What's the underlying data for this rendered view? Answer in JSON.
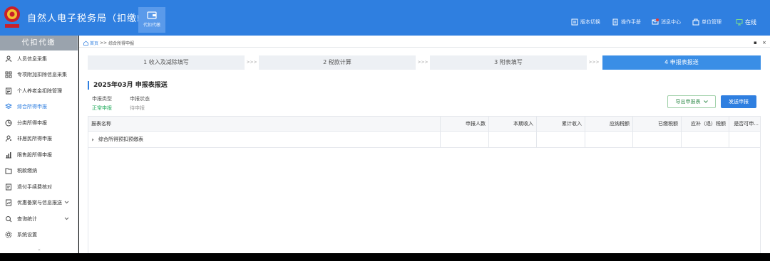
{
  "header": {
    "title": "自然人电子税务局（扣缴端）",
    "module_label": "代扣代缴",
    "actions": [
      {
        "label": "版本切换",
        "icon": "version-switch-icon"
      },
      {
        "label": "操作手册",
        "icon": "manual-icon"
      },
      {
        "label": "消息中心",
        "icon": "message-icon"
      },
      {
        "label": "单位管理",
        "icon": "org-icon"
      }
    ],
    "online_label": "在线",
    "message_badge": "7"
  },
  "sidebar": {
    "title": "代扣代缴",
    "items": [
      {
        "label": "人员信息采集",
        "icon": "person-icon"
      },
      {
        "label": "专项附加扣除信息采集",
        "icon": "grid-icon"
      },
      {
        "label": "个人养老金扣除管理",
        "icon": "doc-icon"
      },
      {
        "label": "综合所得申报",
        "icon": "layers-icon",
        "active": true
      },
      {
        "label": "分类所得申报",
        "icon": "pie-icon"
      },
      {
        "label": "非居民所得申报",
        "icon": "user-outline-icon"
      },
      {
        "label": "限售股所得申报",
        "icon": "chart-icon"
      },
      {
        "label": "税款缴纳",
        "icon": "folder-icon"
      },
      {
        "label": "退付手续费核对",
        "icon": "refund-icon"
      },
      {
        "label": "优惠备案与信息报送",
        "icon": "report-icon",
        "expandable": true
      },
      {
        "label": "查询统计",
        "icon": "query-icon",
        "expandable": true
      },
      {
        "label": "系统设置",
        "icon": "gear-icon"
      }
    ]
  },
  "breadcrumb": {
    "home": "首页",
    "separator": ">>",
    "current": "综合所得申报"
  },
  "steps": [
    {
      "label": "1 收入及减除填写",
      "active": false
    },
    {
      "label": "2 税款计算",
      "active": false
    },
    {
      "label": "3 附表填写",
      "active": false
    },
    {
      "label": "4 申报表报送",
      "active": true
    }
  ],
  "step_separator": ">>>",
  "panel": {
    "title": "2025年03月  申报表报送",
    "declare_type_label": "申报类型",
    "declare_type_value": "正常申报",
    "declare_status_label": "申报状态",
    "declare_status_value": "待申报",
    "export_button": "导出申报表",
    "send_button": "发送申报"
  },
  "table": {
    "columns": [
      "报表名称",
      "申报人数",
      "本期收入",
      "累计收入",
      "应纳税额",
      "已缴税额",
      "应补（退）税额",
      "是否可申..."
    ],
    "rows": [
      {
        "name": "综合所得预扣预缴表"
      }
    ]
  },
  "colors": {
    "brand": "#2f7fe0",
    "active_step": "#3a8ee6",
    "sidebar_head": "#9aa3ad",
    "status_green": "#27ae60"
  }
}
